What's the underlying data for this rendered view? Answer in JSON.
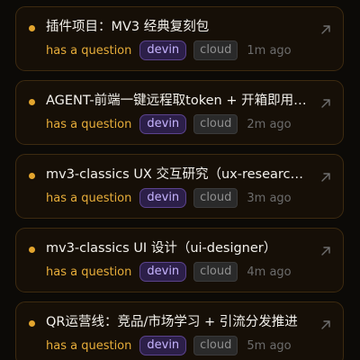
{
  "colors": {
    "status_dot": "#e3a52e",
    "status_text": "#e7ad3a",
    "card_border": "#3d2a10",
    "card_bg": "#160f07",
    "page_bg": "#0c0a07",
    "tag_devin_text": "#c6b4ff",
    "tag_devin_bg": "#2c1f49",
    "tag_cloud_text": "#8f8f8f"
  },
  "sessions": [
    {
      "title": "插件项目：MV3 经典复刻包",
      "status": "has a question",
      "agent_tag": "devin",
      "env_tag": "cloud",
      "time": "1m ago",
      "action_icon": "arrow-up-right-icon"
    },
    {
      "title": "AGENT-前端一键远程取token + 开箱即用…",
      "status": "has a question",
      "agent_tag": "devin",
      "env_tag": "cloud",
      "time": "2m ago",
      "action_icon": "arrow-up-right-icon"
    },
    {
      "title": "mv3-classics UX 交互研究（ux-research…",
      "status": "has a question",
      "agent_tag": "devin",
      "env_tag": "cloud",
      "time": "3m ago",
      "action_icon": "arrow-up-right-icon"
    },
    {
      "title": "mv3-classics UI 设计（ui-designer）",
      "status": "has a question",
      "agent_tag": "devin",
      "env_tag": "cloud",
      "time": "4m ago",
      "action_icon": "arrow-up-right-icon"
    },
    {
      "title": "QR运营线：竞品/市场学习 + 引流分发推进",
      "status": "has a question",
      "agent_tag": "devin",
      "env_tag": "cloud",
      "time": "5m ago",
      "action_icon": "arrow-up-right-icon"
    }
  ]
}
